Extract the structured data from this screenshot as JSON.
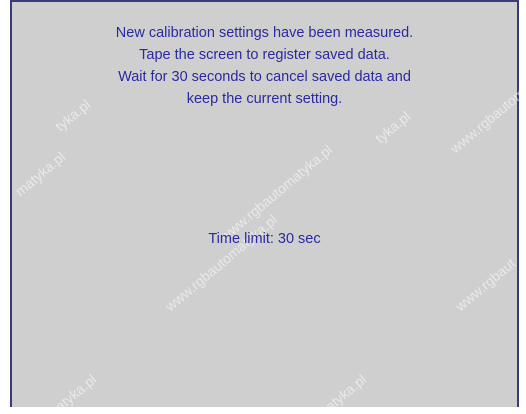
{
  "dialog": {
    "lines": [
      "New calibration settings have been measured.",
      "Tape the screen to register saved data.",
      "Wait for 30 seconds to cancel saved data and",
      "keep the current setting."
    ],
    "time_limit": "Time limit: 30 sec"
  },
  "colors": {
    "background": "#cfcfcf",
    "text": "#2a2aa0",
    "border": "#3a3a78"
  }
}
